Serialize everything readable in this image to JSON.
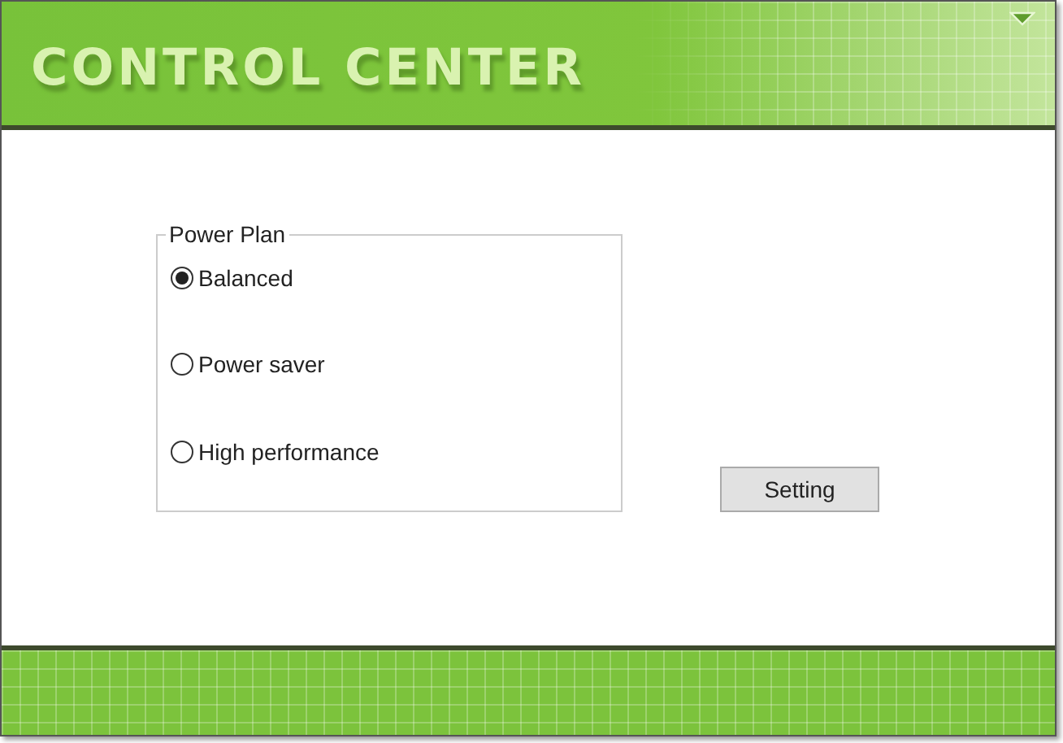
{
  "window": {
    "title": "CONTROL CENTER"
  },
  "power_plan": {
    "title": "Power Plan",
    "options": [
      {
        "label": "Balanced",
        "selected": true
      },
      {
        "label": "Power saver",
        "selected": false
      },
      {
        "label": "High performance",
        "selected": false
      }
    ]
  },
  "buttons": [
    "Setting"
  ]
}
